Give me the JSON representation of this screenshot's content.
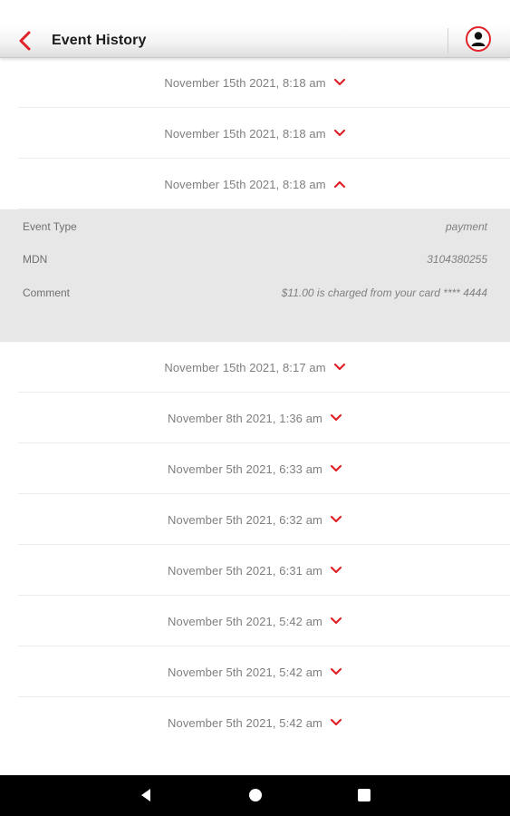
{
  "header": {
    "title": "Event History",
    "accent_color": "#e02128",
    "back_icon": "chevron-left-icon",
    "profile_icon": "user-icon"
  },
  "events": [
    {
      "date": "November 15th 2021, 8:18 am",
      "expanded": false
    },
    {
      "date": "November 15th 2021, 8:18 am",
      "expanded": false
    },
    {
      "date": "November 15th 2021, 8:18 am",
      "expanded": true
    },
    {
      "date": "November 15th 2021, 8:17 am",
      "expanded": false
    },
    {
      "date": "November 8th 2021, 1:36 am",
      "expanded": false
    },
    {
      "date": "November 5th 2021, 6:33 am",
      "expanded": false
    },
    {
      "date": "November 5th 2021, 6:32 am",
      "expanded": false
    },
    {
      "date": "November 5th 2021, 6:31 am",
      "expanded": false
    },
    {
      "date": "November 5th 2021, 5:42 am",
      "expanded": false
    },
    {
      "date": "November 5th 2021, 5:42 am",
      "expanded": false
    },
    {
      "date": "November 5th 2021, 5:42 am",
      "expanded": false
    }
  ],
  "details": [
    {
      "label": "Event Type",
      "value": "payment"
    },
    {
      "label": "MDN",
      "value": "3104380255"
    },
    {
      "label": "Comment",
      "value": "$11.00 is charged from your card **** 4444"
    }
  ],
  "nav": {
    "back_icon": "triangle-back-icon",
    "home_icon": "circle-home-icon",
    "recents_icon": "square-recents-icon"
  }
}
